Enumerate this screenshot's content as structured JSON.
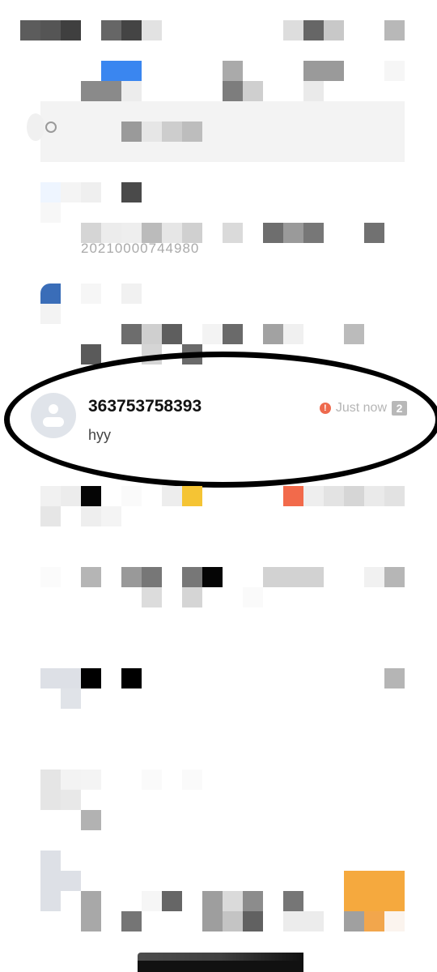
{
  "status_bar": {},
  "search": {
    "placeholder": ""
  },
  "conversation_list": {
    "partial_id": "20210000744980",
    "highlighted": {
      "name": "363753758393",
      "preview": "hyy",
      "time": "Just now",
      "unread_count": "2",
      "status_icon": "error-icon",
      "status_color": "#ee6a4e"
    }
  },
  "colors": {
    "accent_blue": "#3a86f0",
    "accent_orange": "#f5a93e",
    "accent_red": "#f26a4b",
    "accent_yellow": "#f5c434"
  }
}
